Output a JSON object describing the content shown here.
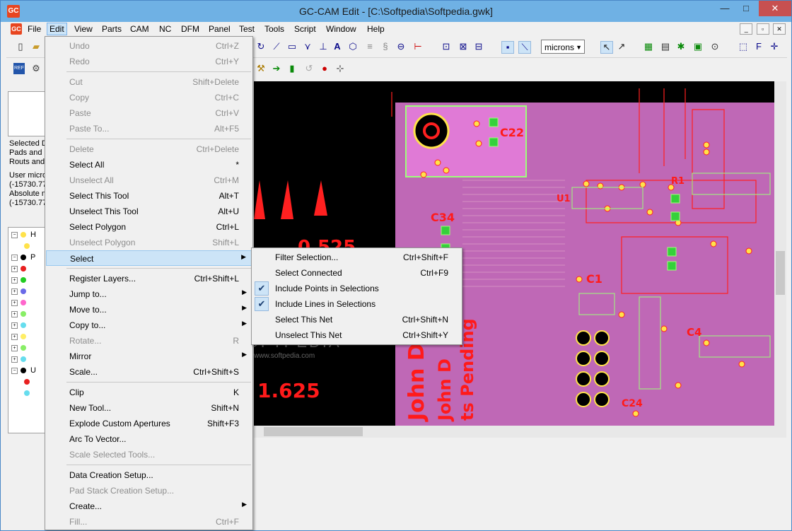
{
  "window": {
    "title": "GC-CAM Edit - [C:\\Softpedia\\Softpedia.gwk]",
    "app_icon": "GC",
    "minimize": "—",
    "maximize": "□",
    "close": "✕"
  },
  "menubar": {
    "items": [
      "File",
      "Edit",
      "View",
      "Parts",
      "CAM",
      "NC",
      "DFM",
      "Panel",
      "Test",
      "Tools",
      "Script",
      "Window",
      "Help"
    ],
    "active": "Edit"
  },
  "toolbar": {
    "units": "microns"
  },
  "left_panel": {
    "lines": [
      "Selected D",
      "Pads and D",
      "Routs and",
      "User micro",
      "(-15730.77",
      "Absolute m",
      "(-15730.77"
    ],
    "tree": [
      {
        "box": "−",
        "color": "#ffe24a",
        "label": "H"
      },
      {
        "box": "",
        "color": "#ffe24a",
        "label": ""
      },
      {
        "box": "−",
        "color": "#000000",
        "label": "P"
      },
      {
        "box": "+",
        "color": "#e82020",
        "label": ""
      },
      {
        "box": "+",
        "color": "#22cc22",
        "label": ""
      },
      {
        "box": "+",
        "color": "#6a6ae8",
        "label": ""
      },
      {
        "box": "+",
        "color": "#ff66cc",
        "label": ""
      },
      {
        "box": "+",
        "color": "#88ee66",
        "label": ""
      },
      {
        "box": "+",
        "color": "#66ddee",
        "label": ""
      },
      {
        "box": "+",
        "color": "#ffee66",
        "label": ""
      },
      {
        "box": "+",
        "color": "#88ee66",
        "label": ""
      },
      {
        "box": "+",
        "color": "#66ddee",
        "label": ""
      },
      {
        "box": "−",
        "color": "#000000",
        "label": "U"
      },
      {
        "box": "",
        "color": "#e82020",
        "label": ""
      },
      {
        "box": "",
        "color": "#66ddee",
        "label": ""
      }
    ]
  },
  "edit_menu": [
    {
      "label": "Undo",
      "shortcut": "Ctrl+Z",
      "disabled": true
    },
    {
      "label": "Redo",
      "shortcut": "Ctrl+Y",
      "disabled": true
    },
    {
      "sep": true
    },
    {
      "label": "Cut",
      "shortcut": "Shift+Delete",
      "disabled": true
    },
    {
      "label": "Copy",
      "shortcut": "Ctrl+C",
      "disabled": true
    },
    {
      "label": "Paste",
      "shortcut": "Ctrl+V",
      "disabled": true
    },
    {
      "label": "Paste To...",
      "shortcut": "Alt+F5",
      "disabled": true
    },
    {
      "sep": true
    },
    {
      "label": "Delete",
      "shortcut": "Ctrl+Delete",
      "disabled": true
    },
    {
      "label": "Select All",
      "shortcut": "*",
      "disabled": false
    },
    {
      "label": "Unselect All",
      "shortcut": "Ctrl+M",
      "disabled": true
    },
    {
      "label": "Select This Tool",
      "shortcut": "Alt+T",
      "disabled": false
    },
    {
      "label": "Unselect This Tool",
      "shortcut": "Alt+U",
      "disabled": false
    },
    {
      "label": "Select Polygon",
      "shortcut": "Ctrl+L",
      "disabled": false
    },
    {
      "label": "Unselect Polygon",
      "shortcut": "Shift+L",
      "disabled": true
    },
    {
      "label": "Select",
      "shortcut": "",
      "disabled": false,
      "submenu": true,
      "highlight": true
    },
    {
      "sep": true
    },
    {
      "label": "Register Layers...",
      "shortcut": "Ctrl+Shift+L",
      "disabled": false
    },
    {
      "label": "Jump to...",
      "shortcut": "",
      "disabled": false,
      "submenu": true
    },
    {
      "label": "Move to...",
      "shortcut": "",
      "disabled": false,
      "submenu": true
    },
    {
      "label": "Copy to...",
      "shortcut": "",
      "disabled": false,
      "submenu": true
    },
    {
      "label": "Rotate...",
      "shortcut": "R",
      "disabled": true
    },
    {
      "label": "Mirror",
      "shortcut": "",
      "disabled": false,
      "submenu": true
    },
    {
      "label": "Scale...",
      "shortcut": "Ctrl+Shift+S",
      "disabled": false
    },
    {
      "sep": true
    },
    {
      "label": "Clip",
      "shortcut": "K",
      "disabled": false
    },
    {
      "label": "New Tool...",
      "shortcut": "Shift+N",
      "disabled": false
    },
    {
      "label": "Explode Custom Apertures",
      "shortcut": "Shift+F3",
      "disabled": false
    },
    {
      "label": "Arc To Vector...",
      "shortcut": "",
      "disabled": false
    },
    {
      "label": "Scale Selected Tools...",
      "shortcut": "",
      "disabled": true
    },
    {
      "sep": true
    },
    {
      "label": "Data Creation Setup...",
      "shortcut": "",
      "disabled": false
    },
    {
      "label": "Pad Stack Creation Setup...",
      "shortcut": "",
      "disabled": true
    },
    {
      "label": "Create...",
      "shortcut": "",
      "disabled": false,
      "submenu": true
    },
    {
      "label": "Fill...",
      "shortcut": "Ctrl+F",
      "disabled": true
    }
  ],
  "select_submenu": [
    {
      "label": "Filter Selection...",
      "shortcut": "Ctrl+Shift+F",
      "checked": false
    },
    {
      "label": "Select Connected",
      "shortcut": "Ctrl+F9",
      "checked": false
    },
    {
      "label": "Include Points in Selections",
      "shortcut": "",
      "checked": true
    },
    {
      "label": "Include Lines in Selections",
      "shortcut": "",
      "checked": true
    },
    {
      "label": "Select This Net",
      "shortcut": "Ctrl+Shift+N",
      "checked": false
    },
    {
      "label": "Unselect This Net",
      "shortcut": "Ctrl+Shift+Y",
      "checked": false
    }
  ],
  "canvas": {
    "labels": [
      "C22",
      "C34",
      "C1",
      "0.525",
      "1.625",
      "C4",
      "C24",
      "U1",
      "R1",
      "John D",
      "John D",
      "ts Pending"
    ]
  },
  "watermark": {
    "big": "SOFTPEDIA",
    "small": "www.softpedia.com"
  }
}
